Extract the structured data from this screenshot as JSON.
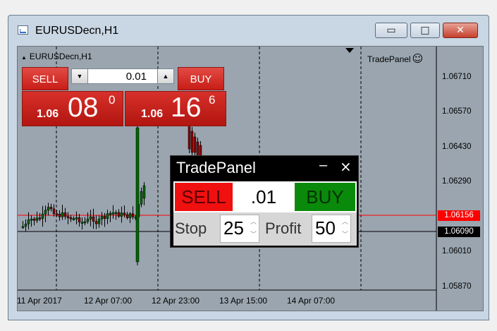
{
  "window": {
    "title": "EURUSDecn,H1",
    "icon": "chart-window-icon",
    "controls": {
      "minimize": "▭",
      "maximize": "□",
      "close": "✕"
    }
  },
  "chart": {
    "symbol_label": "EURUSDecn,H1",
    "expert_label": "TradePanel",
    "expert_icon": "☺",
    "price_labels": [
      "1.06710",
      "1.06570",
      "1.06430",
      "1.06290",
      "1.06010",
      "1.05870"
    ],
    "ask_line_price": "1.06156",
    "bid_line_price": "1.06090",
    "time_labels": [
      "11 Apr 2017",
      "12 Apr 07:00",
      "12 Apr 23:00",
      "13 Apr 15:00",
      "14 Apr 07:00"
    ],
    "colors": {
      "background": "#9aa5af",
      "ask_line": "#ff0000",
      "bid_line": "#000000",
      "bull": "#006400",
      "bear": "#8b0000"
    }
  },
  "one_click": {
    "sell_label": "SELL",
    "buy_label": "BUY",
    "volume": "0.01",
    "spin_down": "▼",
    "spin_up": "▲",
    "bid": {
      "small": "1.06",
      "big": "08",
      "sup": "0"
    },
    "ask": {
      "small": "1.06",
      "big": "16",
      "sup": "6"
    }
  },
  "trade_panel": {
    "title": "TradePanel",
    "minimize": "–",
    "close": "×",
    "sell_label": "SELL",
    "volume": ".01",
    "buy_label": "BUY",
    "stop_label": "Stop",
    "stop_value": "25",
    "profit_label": "Profit",
    "profit_value": "50",
    "spin_up": "︿",
    "spin_down": "﹀"
  }
}
